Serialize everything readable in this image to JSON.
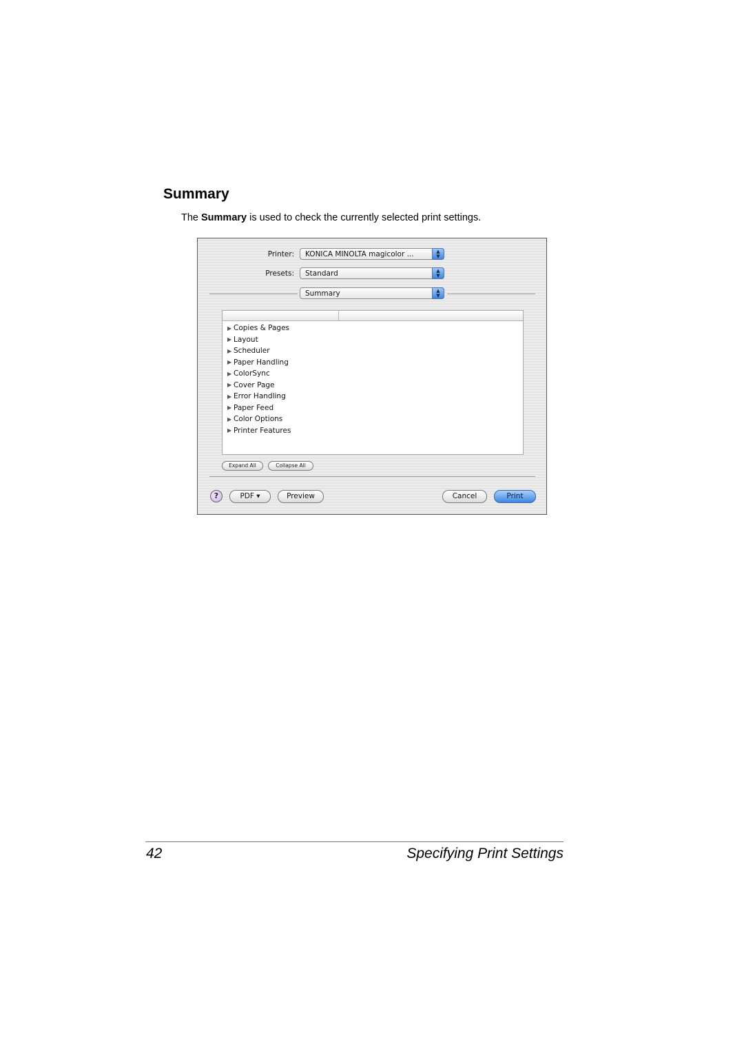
{
  "heading": "Summary",
  "intro": {
    "prefix": "The ",
    "bold": "Summary",
    "suffix": " is used to check the currently selected print settings."
  },
  "dialog": {
    "printer_label": "Printer:",
    "printer_value": "KONICA MINOLTA magicolor ...",
    "presets_label": "Presets:",
    "presets_value": "Standard",
    "panel_value": "Summary",
    "summary_items": [
      "Copies & Pages",
      "Layout",
      "Scheduler",
      "Paper Handling",
      "ColorSync",
      "Cover Page",
      "Error Handling",
      "Paper Feed",
      "Color Options",
      "Printer Features"
    ],
    "expand_all": "Expand All",
    "collapse_all": "Collapse All",
    "help": "?",
    "pdf": "PDF ▾",
    "preview": "Preview",
    "cancel": "Cancel",
    "print": "Print",
    "accent_color": "#3d86e3"
  },
  "footer": {
    "page_number": "42",
    "section_title": "Specifying Print Settings"
  }
}
